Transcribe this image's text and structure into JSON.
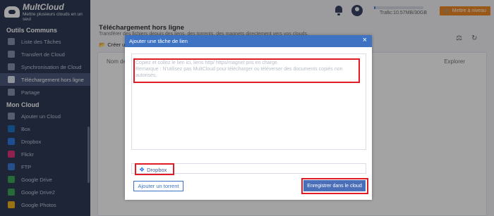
{
  "brand": {
    "name": "MultCloud",
    "tagline_line1": "Mettre plusieurs clouds en un",
    "tagline_line2": "seul"
  },
  "sidebar": {
    "section1": "Outils Communs",
    "tools": [
      {
        "label": "Liste des Tâches",
        "icon": "list-icon"
      },
      {
        "label": "Transfert de Cloud",
        "icon": "transfer-icon"
      },
      {
        "label": "Synchronisation de Cloud",
        "icon": "sync-icon"
      },
      {
        "label": "Téléchargement hors ligne",
        "icon": "cloud-download-icon",
        "active": true
      },
      {
        "label": "Partage",
        "icon": "share-icon"
      }
    ],
    "section2": "Mon Cloud",
    "clouds": [
      {
        "label": "Ajouter un Cloud",
        "icon": "add-cloud-icon"
      },
      {
        "label": "Box",
        "icon": "box-icon",
        "color": "#1d75c9"
      },
      {
        "label": "Dropbox",
        "icon": "dropbox-icon",
        "color": "#2e7ae6"
      },
      {
        "label": "Flickr",
        "icon": "flickr-icon",
        "color": "#e2357a"
      },
      {
        "label": "FTP",
        "icon": "ftp-icon",
        "color": "#3a7ad8"
      },
      {
        "label": "Google Drive",
        "icon": "google-drive-icon",
        "color": "#3aa757"
      },
      {
        "label": "Google Drive2",
        "icon": "google-drive-icon",
        "color": "#3aa757"
      },
      {
        "label": "Google Photos",
        "icon": "google-photos-icon",
        "color": "#f2b31f"
      }
    ]
  },
  "header": {
    "traffic": "Trafic:10.57MB/30GB",
    "traffic_fraction": 0.0004,
    "upgrade": "Mettre à niveau"
  },
  "main": {
    "title": "Téléchargement hors ligne",
    "subtitle": "Transférer des fichiers depuis des liens, des torrents, des magnets directement vers vos clouds.",
    "create": "Créer u",
    "col_name": "Nom de",
    "col_explore": "Explorer"
  },
  "modal": {
    "title": "Ajouter une tâche de lien",
    "close": "×",
    "placeholder_line1": "Copiez et collez le lien ici, liens http/ https/magnet pris en charge.",
    "placeholder_line2": "Remarque : N'utilisez pas MultCloud pour télécharger ou téléverser des documents copiés non autorisés.",
    "cloud_selected": "Dropbox",
    "torrent_button": "Ajouter un torrent",
    "save_button": "Enregistrer dans le cloud"
  },
  "colors": {
    "accent": "#3e73c4",
    "highlight": "#e01b24",
    "upgrade": "#f08a24",
    "sidebar_bg": "#2e3a57"
  }
}
